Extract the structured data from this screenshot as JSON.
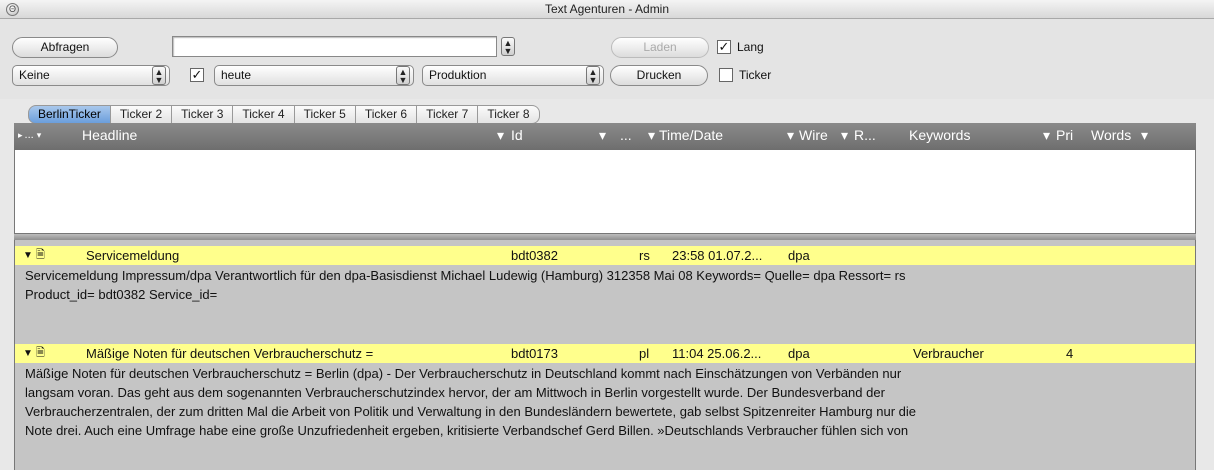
{
  "window": {
    "title": "Text Agenturen - Admin",
    "close_glyph": "Θ"
  },
  "toolbar": {
    "abfragen_label": "Abfragen",
    "query_value": "",
    "laden_label": "Laden",
    "lang_label": "Lang",
    "lang_checked": true,
    "filter_value": "Keine",
    "date_enabled": true,
    "date_value": "heute",
    "production_value": "Produktion",
    "drucken_label": "Drucken",
    "ticker_label": "Ticker",
    "ticker_checked": false
  },
  "tabs": [
    "BerlinTicker",
    "Ticker 2",
    "Ticker 3",
    "Ticker 4",
    "Ticker 5",
    "Ticker 6",
    "Ticker 7",
    "Ticker 8"
  ],
  "columns": {
    "c0": "...",
    "headline": "Headline",
    "id": "Id",
    "c3": "...",
    "time": "Time/Date",
    "wire": "Wire",
    "r": "R...",
    "keywords": "Keywords",
    "pri": "Pri",
    "words": "Words"
  },
  "messages": [
    {
      "headline": "Servicemeldung",
      "id": "bdt0382",
      "code": "rs",
      "time": "23:58 01.07.2...",
      "wire": "dpa",
      "keywords": "",
      "pri": "",
      "body_lines": [
        "Servicemeldung Impressum/dpa Verantwortlich für den dpa-Basisdienst Michael Ludewig (Hamburg) 312358 Mai 08   Keywords=  Quelle= dpa Ressort= rs",
        "Product_id= bdt0382 Service_id="
      ]
    },
    {
      "headline": "Mäßige Noten für deutschen Verbraucherschutz =",
      "id": "bdt0173",
      "code": "pl",
      "time": "11:04 25.06.2...",
      "wire": "dpa",
      "keywords": "Verbraucher",
      "pri": "4",
      "body_lines": [
        "Mäßige Noten für deutschen Verbraucherschutz = Berlin (dpa) - Der Verbraucherschutz in Deutschland kommt nach Einschätzungen von Verbänden nur",
        "langsam voran. Das geht aus dem sogenannten Verbraucherschutzindex hervor, der am Mittwoch in Berlin vorgestellt wurde. Der Bundesverband der",
        "Verbraucherzentralen, der zum dritten Mal die Arbeit von Politik und Verwaltung in den Bundesländern bewertete, gab selbst Spitzenreiter Hamburg nur die",
        "Note drei. Auch eine Umfrage habe eine große Unzufriedenheit ergeben, kritisierte Verbandschef Gerd Billen. »Deutschlands Verbraucher fühlen sich von"
      ]
    }
  ]
}
